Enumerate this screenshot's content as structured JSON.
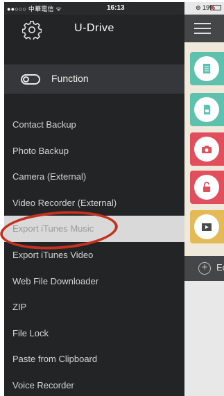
{
  "status_bar": {
    "carrier": "●●○○○ 中華電信 ᯤ",
    "time": "16:13",
    "battery_text": "⊕ 19%"
  },
  "drawer": {
    "title": "U-Drive",
    "settings_icon": "gear-icon",
    "function_label": "Function",
    "toggle_icon": "toggle-icon",
    "menu_items": [
      "Contact Backup",
      "Photo Backup",
      "Camera (External)",
      "Video Recorder (External)",
      "Export iTunes Music",
      "Export iTunes Video",
      "Web File Downloader",
      "ZIP",
      "File Lock",
      "Paste from Clipboard",
      "Voice Recorder"
    ],
    "selected_item": "Export iTunes Music"
  },
  "background_app": {
    "menu_icon": "hamburger-icon",
    "tiles": [
      {
        "icon": "document-icon",
        "color": "#5ec1ae"
      },
      {
        "icon": "sd-card-icon",
        "color": "#5ec1ae"
      },
      {
        "icon": "camera-icon",
        "color": "#e24f5c"
      },
      {
        "icon": "lock-icon",
        "color": "#e24f5c"
      },
      {
        "icon": "video-icon",
        "color": "#e4b957"
      }
    ],
    "bottom_bar_text": "Ec",
    "add_icon": "plus-circle-icon"
  },
  "colors": {
    "drawer_bg": "#232426",
    "function_bar_bg": "#36373a",
    "selected_row_bg": "#d9d9d9",
    "annotation": "#c3321e",
    "teal": "#5ec1ae",
    "red": "#e24f5c",
    "yellow": "#e4b957"
  }
}
